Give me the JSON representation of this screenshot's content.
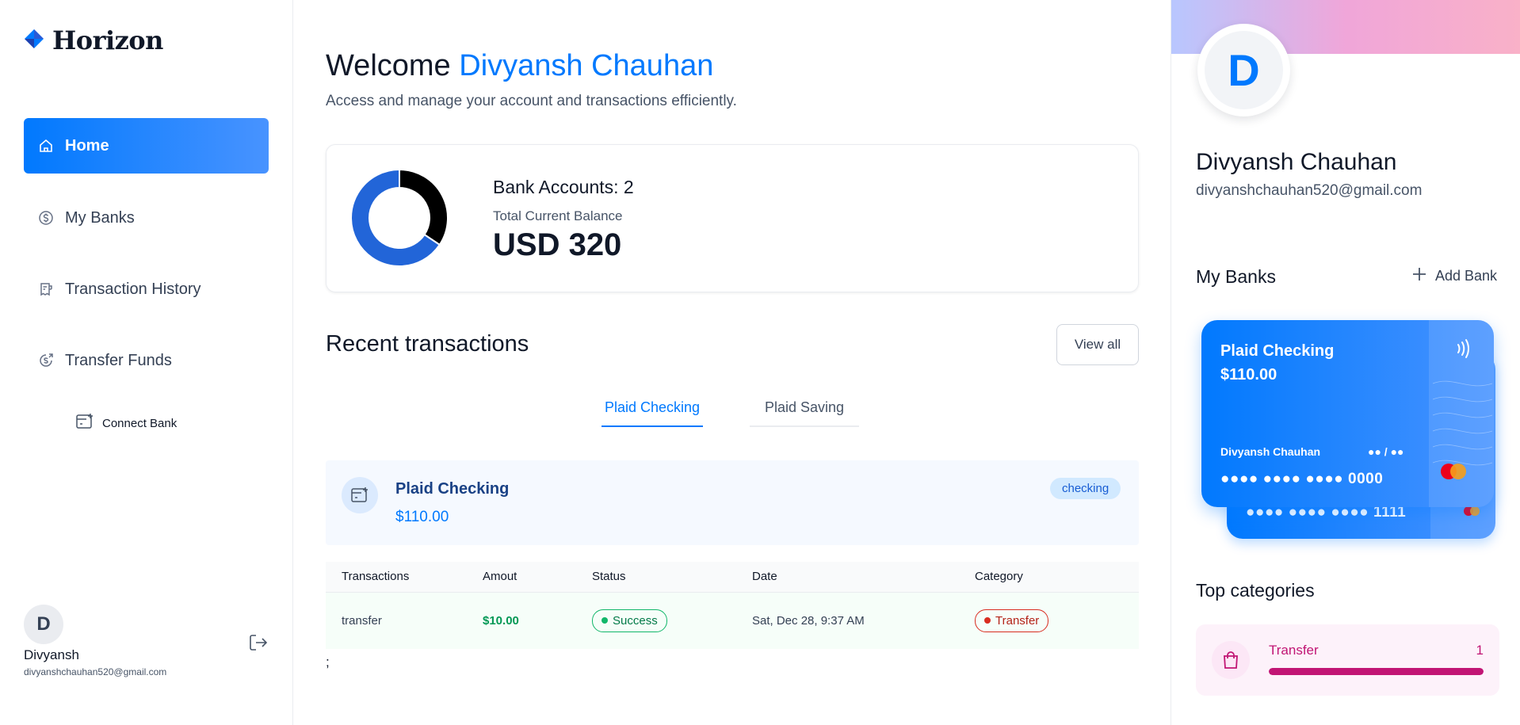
{
  "brand": {
    "name": "Horizon"
  },
  "sidebar": {
    "items": [
      {
        "label": "Home",
        "icon": "home-icon",
        "active": true
      },
      {
        "label": "My Banks",
        "icon": "dollar-circle-icon",
        "active": false
      },
      {
        "label": "Transaction History",
        "icon": "receipt-icon",
        "active": false
      },
      {
        "label": "Transfer Funds",
        "icon": "money-send-icon",
        "active": false
      }
    ],
    "connect_bank": "Connect Bank",
    "footer": {
      "avatar_initial": "D",
      "name": "Divyansh",
      "email": "divyanshchauhan520@gmail.com"
    }
  },
  "header": {
    "welcome_prefix": "Welcome",
    "user_name": "Divyansh Chauhan",
    "subtitle": "Access and manage your account and transactions efficiently."
  },
  "balance": {
    "bank_accounts_label": "Bank Accounts: 2",
    "total_label": "Total Current Balance",
    "total_value": "USD 320",
    "chart_data": {
      "type": "pie",
      "categories": [
        "Plaid Checking",
        "Plaid Saving"
      ],
      "values": [
        110,
        210
      ],
      "colors": [
        "#000000",
        "#2265d8"
      ]
    }
  },
  "recent": {
    "title": "Recent transactions",
    "view_all": "View all",
    "tabs": [
      {
        "label": "Plaid Checking",
        "active": true
      },
      {
        "label": "Plaid Saving",
        "active": false
      }
    ],
    "account": {
      "name": "Plaid Checking",
      "balance": "$110.00",
      "badge": "checking"
    },
    "table": {
      "headers": [
        "Transactions",
        "Amout",
        "Status",
        "Date",
        "Category"
      ],
      "rows": [
        {
          "name": "transfer",
          "amount": "$10.00",
          "status": "Success",
          "date": "Sat, Dec 28, 9:37 AM",
          "category": "Transfer"
        }
      ]
    },
    "trailing_text": ";"
  },
  "profile": {
    "avatar_initial": "D",
    "name": "Divyansh Chauhan",
    "email": "divyanshchauhan520@gmail.com"
  },
  "my_banks": {
    "title": "My Banks",
    "add_label": "Add Bank",
    "cards": [
      {
        "name": "Plaid Checking",
        "balance": "$110.00",
        "owner": "Divyansh Chauhan",
        "expiry": "●● / ●●",
        "mask": "●●●● ●●●● ●●●● 0000"
      },
      {
        "mask": "●●●● ●●●● ●●●● 1111"
      }
    ]
  },
  "top_categories": {
    "title": "Top categories",
    "items": [
      {
        "name": "Transfer",
        "count": "1",
        "progress": 1.0
      }
    ]
  },
  "colors": {
    "accent": "#0179fe",
    "success": "#12b76a",
    "danger": "#d92d20",
    "category": "#c11574"
  }
}
